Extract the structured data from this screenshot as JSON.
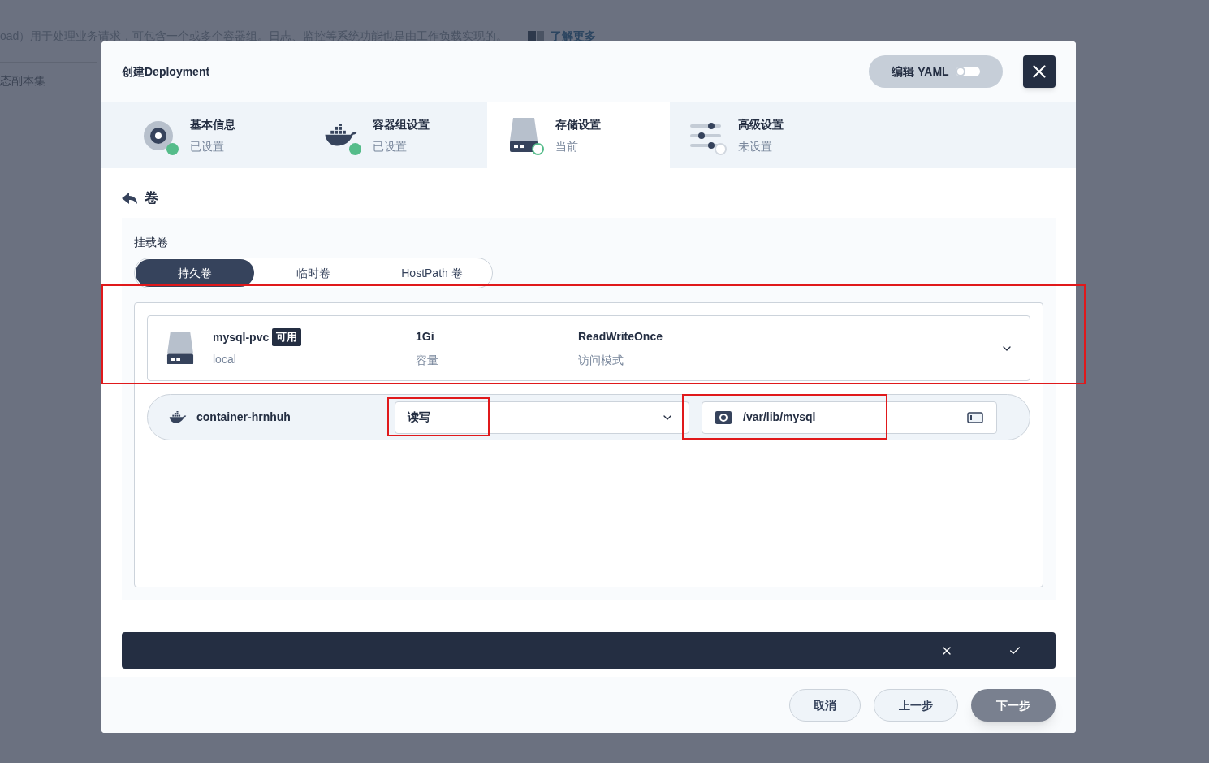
{
  "background": {
    "description": "oad）用于处理业务请求，可包含一个或多个容器组。日志、监控等系统功能也是由工作负载实现的。",
    "link": "了解更多",
    "tab": "态副本集"
  },
  "dialog": {
    "title": "创建Deployment",
    "yaml_toggle": {
      "label": "编辑 YAML",
      "on": false
    }
  },
  "steps": [
    {
      "title": "基本信息",
      "status_text": "已设置",
      "kind": "info",
      "completed": true,
      "selected": false
    },
    {
      "title": "容器组设置",
      "status_text": "已设置",
      "kind": "container",
      "completed": true,
      "selected": false
    },
    {
      "title": "存储设置",
      "status_text": "当前",
      "kind": "storage",
      "completed": false,
      "selected": true
    },
    {
      "title": "高级设置",
      "status_text": "未设置",
      "kind": "advanced",
      "completed": false,
      "selected": false
    }
  ],
  "section": {
    "title": "卷"
  },
  "mount": {
    "label": "挂载卷",
    "tabs": [
      {
        "label": "持久卷",
        "selected": true
      },
      {
        "label": "临时卷",
        "selected": false
      },
      {
        "label": "HostPath 卷",
        "selected": false
      }
    ]
  },
  "volume": {
    "name": "mysql-pvc",
    "badge": "可用",
    "storage_class": "local",
    "capacity": "1Gi",
    "capacity_label": "容量",
    "access_mode": "ReadWriteOnce",
    "access_mode_label": "访问模式"
  },
  "container_mount": {
    "container": "container-hrnhuh",
    "mode": "读写",
    "path": "/var/lib/mysql"
  },
  "footer": {
    "buttons": [
      {
        "label": "取消",
        "kind": "secondary"
      },
      {
        "label": "上一步",
        "kind": "secondary"
      },
      {
        "label": "下一步",
        "kind": "primary"
      }
    ]
  }
}
